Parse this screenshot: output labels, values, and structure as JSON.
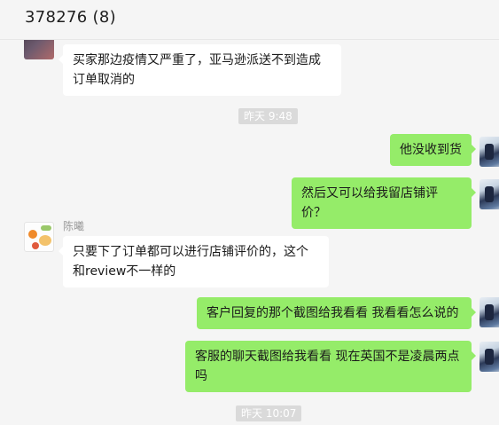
{
  "header": {
    "title": "378276  (8)"
  },
  "messages": [
    {
      "side": "in",
      "text": "买家那边疫情又严重了，亚马逊派送不到造成订单取消的"
    },
    {
      "type": "timestamp",
      "text": "昨天 9:48"
    },
    {
      "side": "out",
      "text": "他没收到货"
    },
    {
      "side": "out",
      "text": "然后又可以给我留店铺评价？"
    },
    {
      "side": "in",
      "sender": "陈曦",
      "text": "只要下了订单都可以进行店铺评价的，这个和review不一样的"
    },
    {
      "side": "out",
      "text": "客户回复的那个截图给我看看  我看看怎么说的"
    },
    {
      "side": "out",
      "text": "客服的聊天截图给我看看  现在英国不是凌晨两点吗"
    },
    {
      "type": "timestamp",
      "text": "昨天 10:07"
    }
  ],
  "colors": {
    "out_bubble": "#95ec69",
    "in_bubble": "#ffffff",
    "background": "#f5f5f5"
  }
}
